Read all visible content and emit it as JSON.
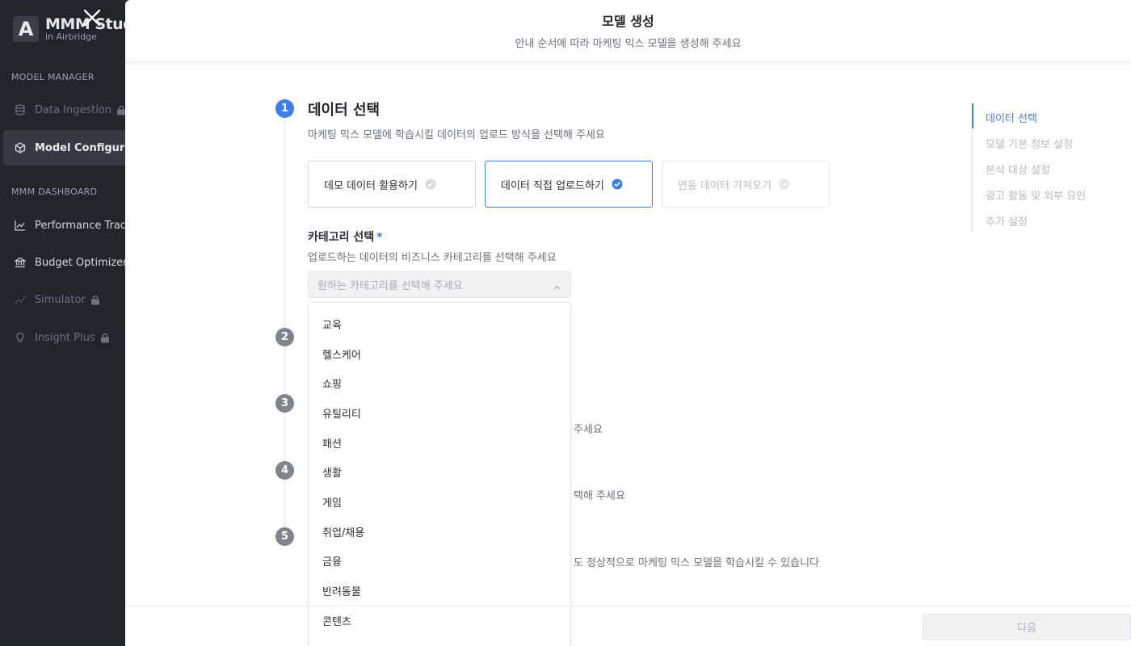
{
  "app": {
    "logo_letter": "A",
    "logo_title": "MMM Studio",
    "logo_subtitle": "in Airbridge"
  },
  "sidebar": {
    "section_model_manager": "MODEL MANAGER",
    "section_dashboard": "MMM DASHBOARD",
    "items": [
      {
        "label": "Data Ingestion",
        "icon": "database-icon",
        "locked": true,
        "state": "muted"
      },
      {
        "label": "Model Configuration",
        "icon": "cube-icon",
        "locked": false,
        "state": "active"
      },
      {
        "label": "Performance Tracker",
        "icon": "line-chart-icon",
        "locked": false,
        "state": "normal"
      },
      {
        "label": "Budget Optimizer",
        "icon": "bank-icon",
        "locked": false,
        "state": "normal"
      },
      {
        "label": "Simulator",
        "icon": "trend-icon",
        "locked": true,
        "state": "muted"
      },
      {
        "label": "Insight Plus",
        "icon": "lightbulb-icon",
        "locked": true,
        "state": "muted"
      }
    ]
  },
  "modal": {
    "title": "모델 생성",
    "subtitle": "안내 순서에 따라 마케팅 믹스 모델을 생성해 주세요"
  },
  "steps": {
    "numbers": [
      "1",
      "2",
      "3",
      "4",
      "5"
    ],
    "step1": {
      "title": "데이터 선택",
      "description": "마케팅 믹스 모델에 학습시킬 데이터의 업로드 방식을 선택해 주세요",
      "options": [
        {
          "label": "데모 데이터 활용하기",
          "state": "default"
        },
        {
          "label": "데이터 직접 업로드하기",
          "state": "selected"
        },
        {
          "label": "연동 데이터 가져오기",
          "state": "disabled"
        }
      ]
    },
    "hint3": "주세요",
    "hint4": "택해 주세요",
    "hint5": "도 정상적으로 마케팅 믹스 모델을 학습시킬 수 있습니다"
  },
  "category": {
    "label": "카테고리 선택",
    "required_mark": "*",
    "description": "업로드하는 데이터의 비즈니스 카테고리를 선택해 주세요",
    "placeholder": "원하는 카테고리를 선택해 주세요",
    "options": [
      "교육",
      "헬스케어",
      "쇼핑",
      "유틸리티",
      "패션",
      "생활",
      "게임",
      "취업/채용",
      "금융",
      "반려동물",
      "콘텐츠"
    ]
  },
  "toc": {
    "items": [
      "데이터 선택",
      "모델 기본 정보 설정",
      "분석 대상 설정",
      "광고 활동 및 외부 요인",
      "추가 설정"
    ],
    "active_index": 0
  },
  "footer": {
    "next_label": "다음"
  },
  "colors": {
    "accent": "#3f7de8",
    "sidebar_bg": "#22252a",
    "step_inactive": "#80848b"
  }
}
